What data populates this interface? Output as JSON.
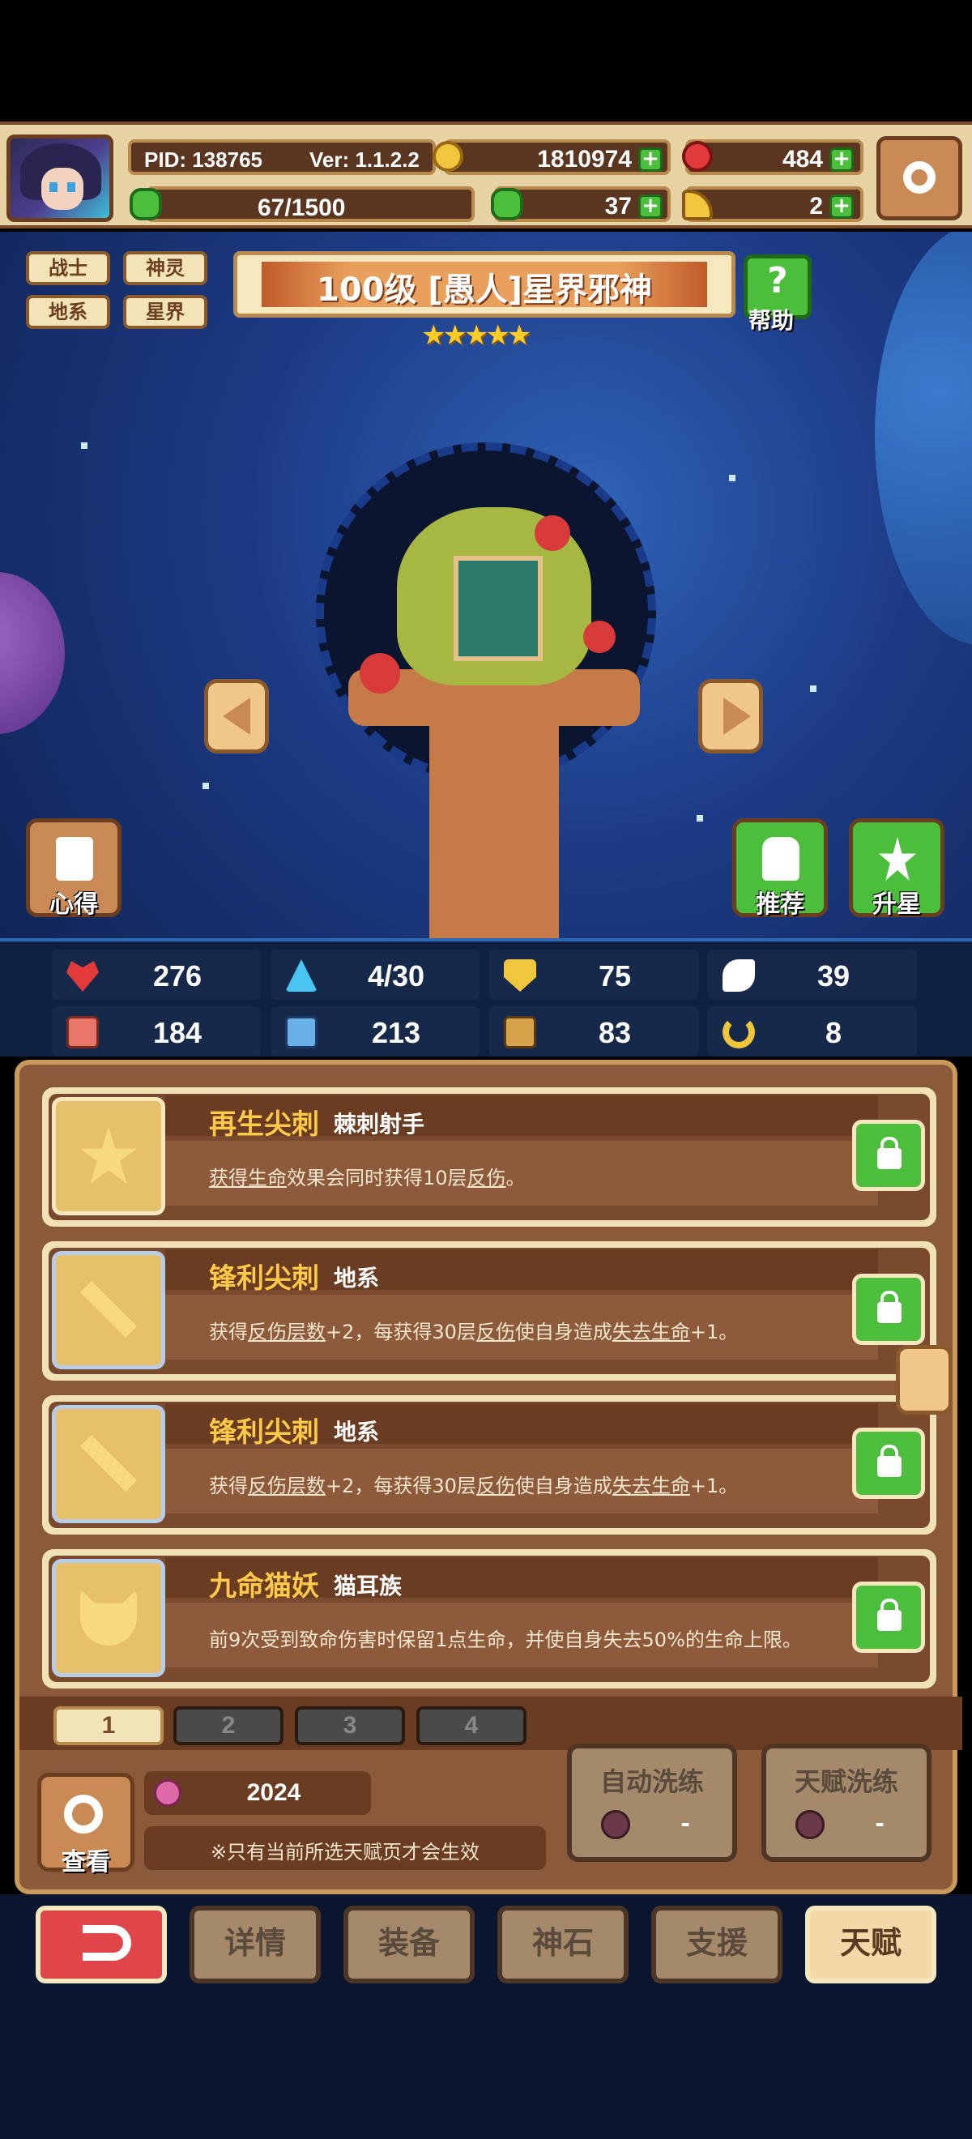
{
  "header": {
    "pid": "PID: 138765",
    "version": "Ver: 1.1.2.2",
    "gold": "1810974",
    "gems": "484",
    "stamina": "67/1500",
    "clover": "37",
    "boots": "2"
  },
  "hero": {
    "tags": [
      "战士",
      "神灵",
      "地系",
      "星界"
    ],
    "title": "100级 [愚人]星界邪神",
    "stars": "★★★★★",
    "help_label": "帮助",
    "help_glyph": "?",
    "left_button": "心得",
    "recommend_button": "推荐",
    "star_up_button": "升星"
  },
  "stats": [
    "276",
    "4/30",
    "75",
    "39",
    "184",
    "213",
    "83",
    "8"
  ],
  "talents": [
    {
      "name": "再生尖刺",
      "sub": "棘刺射手",
      "desc": [
        {
          "t": "获得生命",
          "u": true
        },
        {
          "t": "效果会同时获得10层",
          "u": false
        },
        {
          "t": "反伤",
          "u": true
        },
        {
          "t": "。",
          "u": false
        }
      ]
    },
    {
      "name": "锋利尖刺",
      "sub": "地系",
      "desc": [
        {
          "t": "获得",
          "u": false
        },
        {
          "t": "反伤层数",
          "u": true
        },
        {
          "t": "+2，每获得30层",
          "u": false
        },
        {
          "t": "反伤",
          "u": true
        },
        {
          "t": "使自身造成",
          "u": false
        },
        {
          "t": "失去生命",
          "u": true
        },
        {
          "t": "+1。",
          "u": false
        }
      ]
    },
    {
      "name": "锋利尖刺",
      "sub": "地系",
      "desc": [
        {
          "t": "获得",
          "u": false
        },
        {
          "t": "反伤层数",
          "u": true
        },
        {
          "t": "+2，每获得30层",
          "u": false
        },
        {
          "t": "反伤",
          "u": true
        },
        {
          "t": "使自身造成",
          "u": false
        },
        {
          "t": "失去生命",
          "u": true
        },
        {
          "t": "+1。",
          "u": false
        }
      ]
    },
    {
      "name": "九命猫妖",
      "sub": "猫耳族",
      "desc": [
        {
          "t": "前9次受到致命伤害时保留1点生命，并使自身失去50%的生命上限。",
          "u": false
        }
      ]
    }
  ],
  "pages": [
    "1",
    "2",
    "3",
    "4"
  ],
  "footer": {
    "view_label": "查看",
    "berry_count": "2024",
    "note": "※只有当前所选天赋页才会生效",
    "auto_reroll": "自动洗练",
    "auto_reroll_cost": "-",
    "talent_reroll": "天赋洗练",
    "talent_reroll_cost": "-"
  },
  "nav": [
    "详情",
    "装备",
    "神石",
    "支援",
    "天赋"
  ],
  "icons": {
    "stats": [
      "heart-icon",
      "water-drop-icon",
      "shield-icon",
      "wing-icon",
      "fist-icon",
      "book-icon",
      "boot-icon",
      "horseshoe-icon"
    ],
    "colors": [
      "#e23a3a",
      "#4ac4f0",
      "#f0c63c",
      "#ffffff",
      "#e8756a",
      "#6ab0e8",
      "#d6a24a",
      "#f0c63c"
    ]
  }
}
